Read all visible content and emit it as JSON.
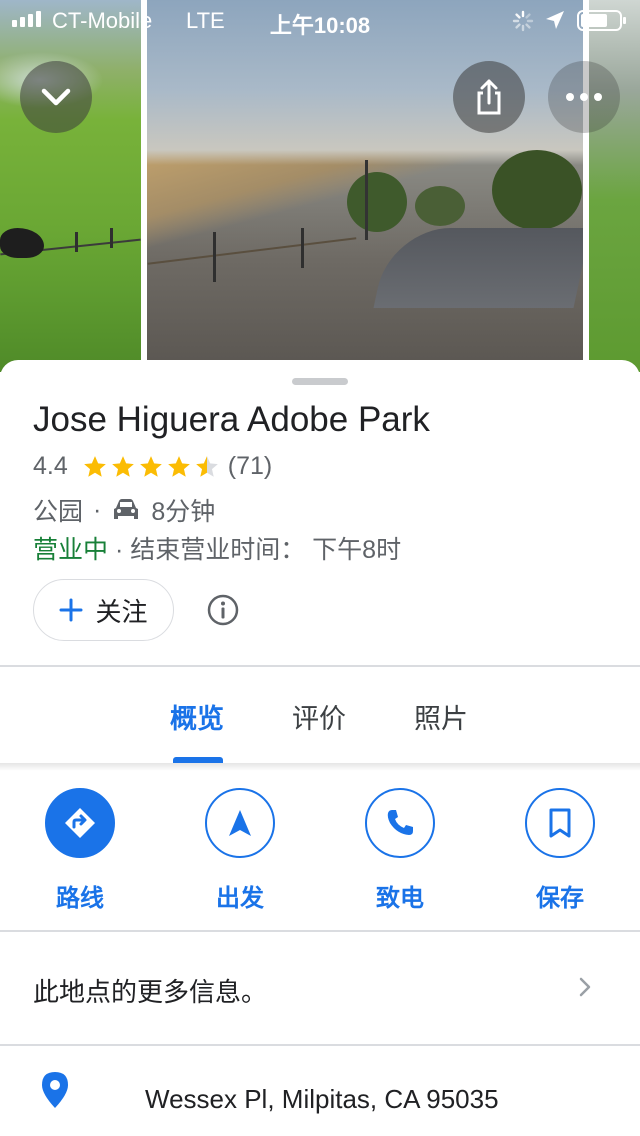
{
  "status_bar": {
    "carrier": "CT-Mobile",
    "network": "LTE",
    "time": "上午10:08"
  },
  "header": {
    "collapse_icon": "chevron-down-icon",
    "share_icon": "share-icon",
    "more_icon": "more-horizontal-icon"
  },
  "place": {
    "name": "Jose Higuera Adobe Park",
    "rating": "4.4",
    "rating_value": 4.4,
    "stars_max": 5,
    "review_count": "(71)",
    "category": "公园",
    "separator": "·",
    "drive_time": "8分钟",
    "open_status": "营业中",
    "hours_text": "· 结束营业时间： 下午8时"
  },
  "follow": {
    "label": "关注"
  },
  "tabs": [
    {
      "label": "概览",
      "active": true
    },
    {
      "label": "评价",
      "active": false
    },
    {
      "label": "照片",
      "active": false
    }
  ],
  "actions": [
    {
      "label": "路线",
      "icon": "directions-icon"
    },
    {
      "label": "出发",
      "icon": "navigation-arrow-icon"
    },
    {
      "label": "致电",
      "icon": "phone-icon"
    },
    {
      "label": "保存",
      "icon": "bookmark-icon"
    }
  ],
  "more_info": {
    "label": "此地点的更多信息。"
  },
  "address": {
    "text": "Wessex Pl, Milpitas, CA 95035"
  },
  "colors": {
    "accent": "#1a73e8",
    "open_green": "#188038",
    "star_yellow": "#fbbc04",
    "text_secondary": "#5f6368"
  }
}
